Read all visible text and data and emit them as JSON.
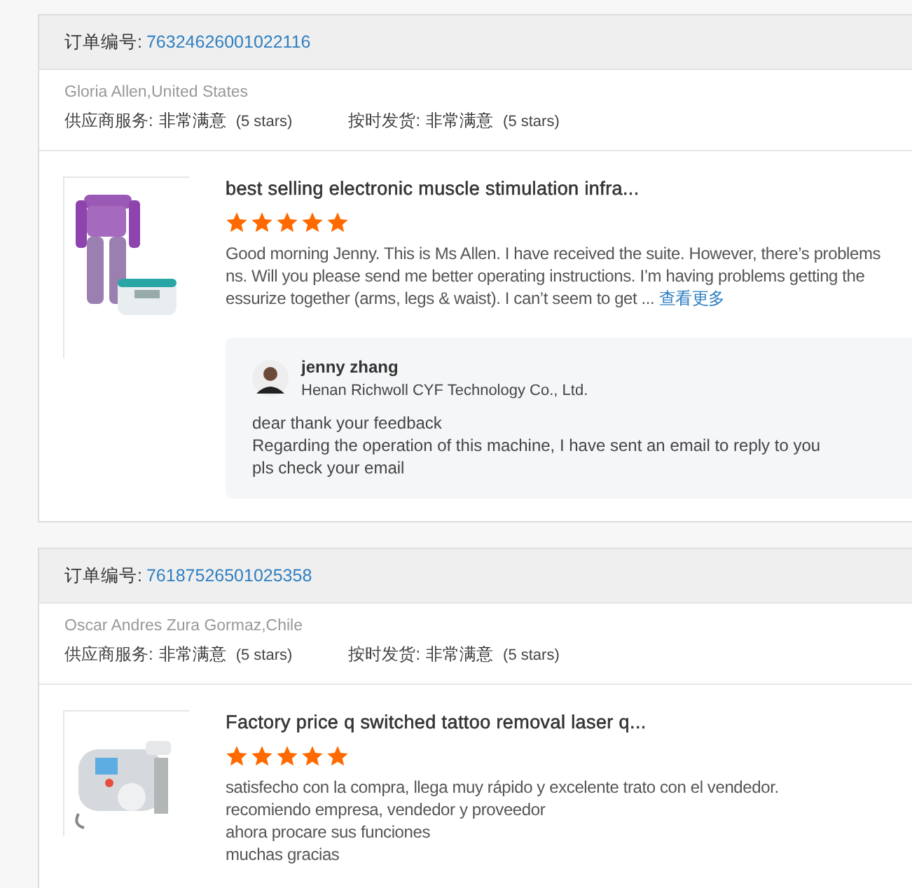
{
  "orders": [
    {
      "order_label": "订单编号:",
      "order_no": "76324626001022116",
      "buyer": "Gloria Allen,United States",
      "ratings": [
        {
          "label": "供应商服务:",
          "value": "非常满意",
          "note": "(5 stars)"
        },
        {
          "label": "按时发货:",
          "value": "非常满意",
          "note": "(5 stars)"
        }
      ],
      "product": {
        "kind": "suit",
        "title": "best selling electronic muscle stimulation infra...",
        "stars": 5,
        "review_lines": [
          "Good morning Jenny. This is Ms Allen. I have received the suite. However, there’s problems",
          "ns. Will you please send me better operating instructions. I’m having problems getting the",
          "essurize together (arms, legs & waist).  I can’t seem to get ... "
        ],
        "more_link": "查看更多"
      },
      "reply": {
        "name": "jenny zhang",
        "company": "Henan Richwoll CYF Technology Co., Ltd.",
        "lines": [
          "dear thank  your feedback",
          "Regarding the operation of this machine, I have sent an email to reply to you",
          "pls check your email"
        ]
      }
    },
    {
      "order_label": "订单编号:",
      "order_no": "76187526501025358",
      "buyer": "Oscar Andres Zura Gormaz,Chile",
      "ratings": [
        {
          "label": "供应商服务:",
          "value": "非常满意",
          "note": "(5 stars)"
        },
        {
          "label": "按时发货:",
          "value": "非常满意",
          "note": "(5 stars)"
        }
      ],
      "product": {
        "kind": "machine",
        "title": "Factory price q switched tattoo removal laser q...",
        "stars": 5,
        "review_lines": [
          "satisfecho con la compra, llega muy rápido y excelente trato con el vendedor.",
          "recomiendo empresa, vendedor y proveedor",
          "ahora procare sus funciones",
          "muchas gracias"
        ]
      }
    }
  ]
}
